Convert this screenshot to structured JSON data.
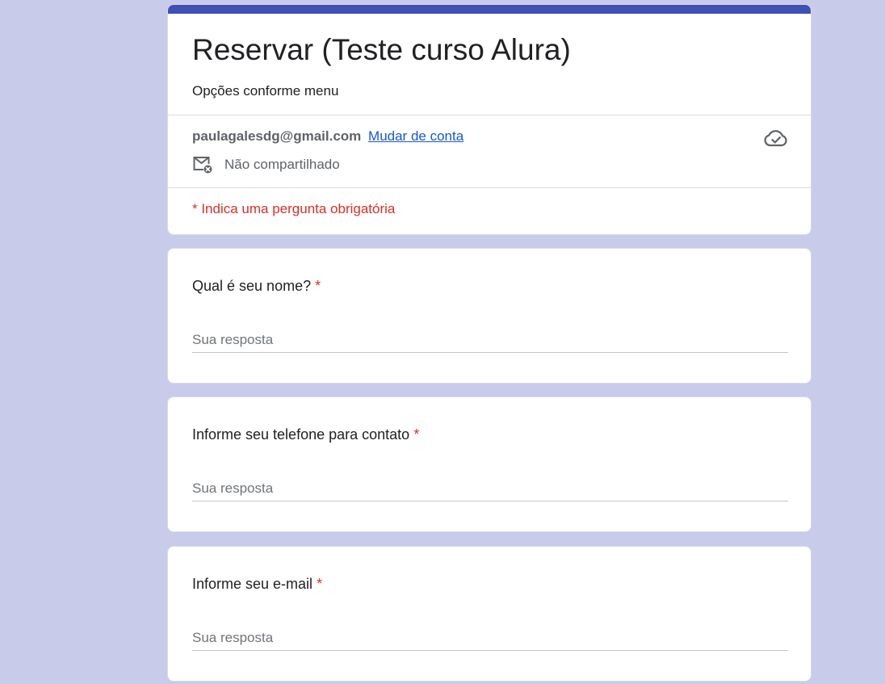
{
  "form": {
    "title": "Reservar (Teste curso Alura)",
    "description": "Opções conforme menu",
    "accent_color": "#3f51b5",
    "background_color": "#c8cbea"
  },
  "account": {
    "email": "paulagalesdg@gmail.com",
    "switch_label": "Mudar de conta",
    "share_status": "Não compartilhado",
    "share_icon": "mail-not-shared-icon",
    "sync_icon": "cloud-done-icon"
  },
  "required_note": "* Indica uma pergunta obrigatória",
  "required_mark": "*",
  "questions": [
    {
      "title": "Qual é seu nome?",
      "placeholder": "Sua resposta",
      "value": ""
    },
    {
      "title": "Informe seu telefone para contato",
      "placeholder": "Sua resposta",
      "value": ""
    },
    {
      "title": "Informe seu e-mail",
      "placeholder": "Sua resposta",
      "value": ""
    }
  ]
}
